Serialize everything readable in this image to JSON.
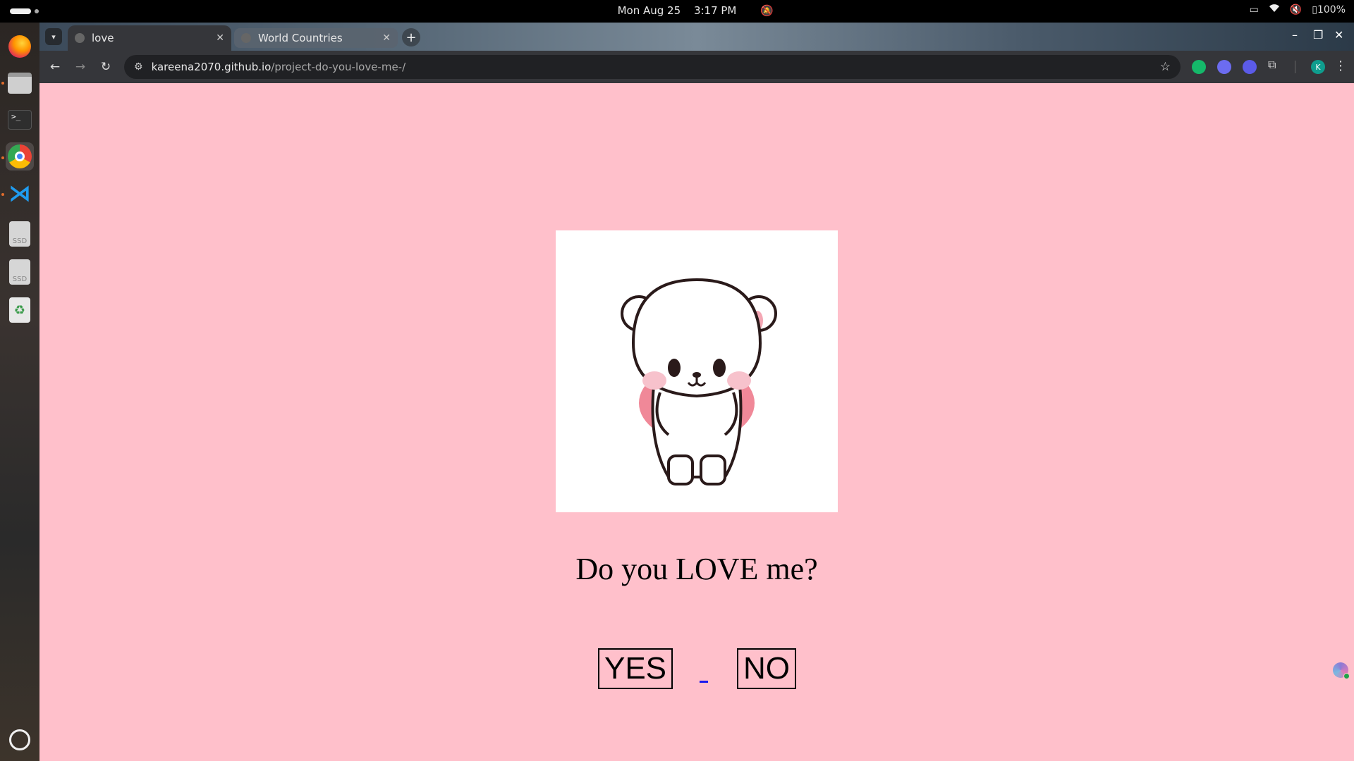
{
  "topbar": {
    "date": "Mon Aug 25",
    "time": "3:17 PM",
    "battery": "100%"
  },
  "dock": {
    "items": [
      "firefox-icon",
      "files-icon",
      "terminal-icon",
      "chrome-icon",
      "vscode-icon",
      "ssd-drive-icon",
      "ssd-drive-icon",
      "trash-icon",
      "show-apps-icon"
    ],
    "ssd_label": "SSD",
    "terminal_prompt": ">_"
  },
  "browser": {
    "tabs": [
      {
        "title": "love",
        "active": true
      },
      {
        "title": "World Countries",
        "active": false
      }
    ],
    "url_host": "kareena2070.github.io",
    "url_path": "/project-do-you-love-me-/",
    "profile_initial": "K"
  },
  "page": {
    "background": "#ffc0cb",
    "question": "Do you LOVE me?",
    "yes_label": "YES",
    "no_label": "NO",
    "image": "cute-bear"
  }
}
